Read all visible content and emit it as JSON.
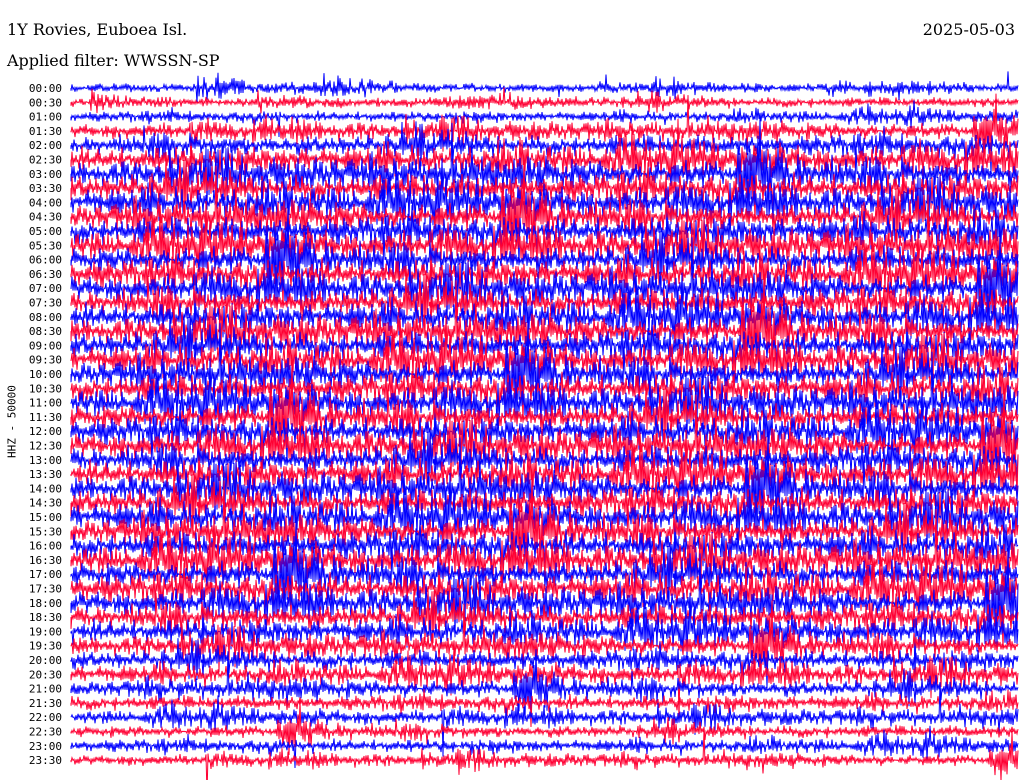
{
  "header": {
    "station": "1Y Rovies, Euboea Isl.",
    "date": "2025-05-03",
    "filter": "Applied filter: WWSSN-SP"
  },
  "chart_data": {
    "type": "line",
    "title": "1Y Rovies, Euboea Isl.",
    "ylabel": "HHZ - 50000",
    "xlabel": "",
    "row_minutes": 30,
    "series_colors": [
      "#0000ff",
      "#ff0033"
    ],
    "tick_labels": [
      "00:00",
      "00:30",
      "01:00",
      "01:30",
      "02:00",
      "02:30",
      "03:00",
      "03:30",
      "04:00",
      "04:30",
      "05:00",
      "05:30",
      "06:00",
      "06:30",
      "07:00",
      "07:30",
      "08:00",
      "08:30",
      "09:00",
      "09:30",
      "10:00",
      "10:30",
      "11:00",
      "11:30",
      "12:00",
      "12:30",
      "13:00",
      "13:30",
      "14:00",
      "14:30",
      "15:00",
      "15:30",
      "16:00",
      "16:30",
      "17:00",
      "17:30",
      "18:00",
      "18:30",
      "19:00",
      "19:30",
      "20:00",
      "20:30",
      "21:00",
      "21:30",
      "22:00",
      "22:30",
      "23:00",
      "23:30"
    ],
    "relative_amplitude": [
      0.2,
      0.25,
      0.25,
      0.5,
      0.7,
      0.9,
      1,
      1,
      1,
      1,
      1,
      1,
      1,
      1,
      1,
      1,
      1,
      1,
      1,
      1,
      1,
      1,
      1,
      1,
      1,
      1,
      1,
      1,
      1,
      1,
      1,
      1,
      1,
      1,
      1,
      1,
      0.95,
      0.9,
      0.85,
      0.7,
      0.65,
      0.6,
      0.55,
      0.45,
      0.4,
      0.35,
      0.35,
      0.3
    ]
  }
}
